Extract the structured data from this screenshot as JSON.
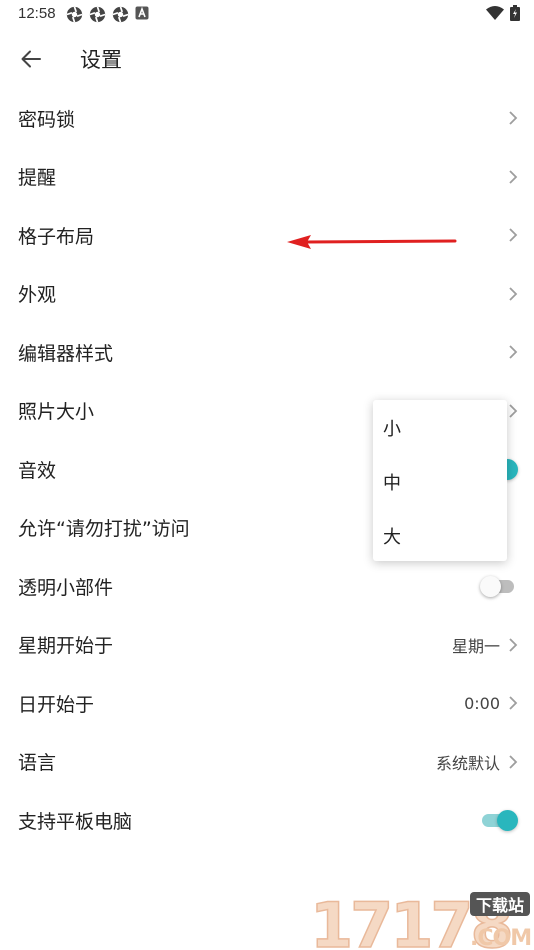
{
  "status_bar": {
    "time": "12:58",
    "notification_icons": [
      "aperture-icon",
      "aperture-icon",
      "aperture-icon",
      "app-a-icon"
    ],
    "right_icons": [
      "wifi-icon",
      "battery-icon"
    ]
  },
  "app_bar": {
    "back_icon": "arrow-left-icon",
    "title": "设置"
  },
  "settings": [
    {
      "label": "密码锁",
      "control": "chevron"
    },
    {
      "label": "提醒",
      "control": "chevron"
    },
    {
      "label": "格子布局",
      "control": "chevron"
    },
    {
      "label": "外观",
      "control": "chevron"
    },
    {
      "label": "编辑器样式",
      "control": "chevron"
    },
    {
      "label": "照片大小",
      "control": "chevron"
    },
    {
      "label": "音效",
      "control": "toggle",
      "enabled": true
    },
    {
      "label": "允许“请勿打扰”访问",
      "control": "none"
    },
    {
      "label": "透明小部件",
      "control": "toggle",
      "enabled": false
    },
    {
      "label": "星期开始于",
      "control": "chevron",
      "value": "星期一"
    },
    {
      "label": "日开始于",
      "control": "chevron",
      "value": "0:00"
    },
    {
      "label": "语言",
      "control": "chevron",
      "value": "系统默认"
    },
    {
      "label": "支持平板电脑",
      "control": "toggle",
      "enabled": true
    }
  ],
  "popup_menu": {
    "items": [
      "小",
      "中",
      "大"
    ]
  },
  "watermark": {
    "digits": "17178",
    "badge": "下载站",
    "domain": ".COM"
  },
  "colors": {
    "accent": "#29b6bd",
    "accent_track": "#8fd3d6",
    "annotation_arrow": "#e02020"
  }
}
